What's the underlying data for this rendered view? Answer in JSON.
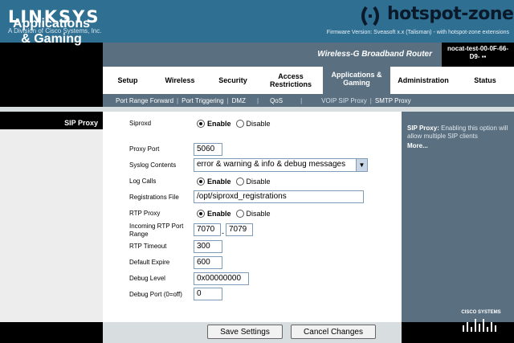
{
  "header": {
    "brand": "LINKSYS",
    "brand_sub": "A Division of Cisco Systems, Inc.",
    "partner": "hotspot-zone",
    "firmware": "Firmware Version: Sveasoft x.x (Talisman) - with hotspot-zone extensions"
  },
  "section": {
    "title_line1": "Applications",
    "title_line2": "& Gaming"
  },
  "model": "Wireless-G Broadband Router",
  "host": {
    "line1": "nocat-test-00-0F-66-",
    "line2": "D9-"
  },
  "tabs": [
    {
      "label": "Setup"
    },
    {
      "label": "Wireless"
    },
    {
      "label": "Security"
    },
    {
      "label": "Access Restrictions"
    },
    {
      "label": "Applications & Gaming"
    },
    {
      "label": "Administration"
    },
    {
      "label": "Status"
    }
  ],
  "subnav": [
    "Port Range Forward",
    "Port Triggering",
    "DMZ",
    "QoS",
    "VOIP SIP Proxy",
    "SMTP Proxy"
  ],
  "left_label": "SIP Proxy",
  "form": {
    "siproxd": {
      "label": "Siproxd",
      "enable": "Enable",
      "disable": "Disable"
    },
    "proxy_port": {
      "label": "Proxy Port",
      "value": "5060"
    },
    "syslog": {
      "label": "Syslog Contents",
      "value": "error & warning & info & debug messages"
    },
    "log_calls": {
      "label": "Log Calls",
      "enable": "Enable",
      "disable": "Disable"
    },
    "reg_file": {
      "label": "Registrations File",
      "value": "/opt/siproxd_registrations"
    },
    "rtp_proxy": {
      "label": "RTP Proxy",
      "enable": "Enable",
      "disable": "Disable"
    },
    "rtp_range": {
      "label_line1": "Incoming RTP Port",
      "label_line2": "Range",
      "start": "7070",
      "end": "7079",
      "sep": "-"
    },
    "rtp_timeout": {
      "label": "RTP Timeout",
      "value": "300"
    },
    "default_expire": {
      "label": "Default Expire",
      "value": "600"
    },
    "debug_level": {
      "label": "Debug Level",
      "value": "0x00000000"
    },
    "debug_port": {
      "label": "Debug Port (0=off)",
      "value": "0"
    }
  },
  "help": {
    "title": "SIP Proxy:",
    "text": "Enabling this option will allow multiple SIP clients",
    "more": "More..."
  },
  "buttons": {
    "save": "Save Settings",
    "cancel": "Cancel Changes"
  },
  "footer_logo": "CISCO SYSTEMS",
  "colors": {
    "header": "#2f6f92",
    "panel": "#5a6f80",
    "black": "#000000"
  }
}
